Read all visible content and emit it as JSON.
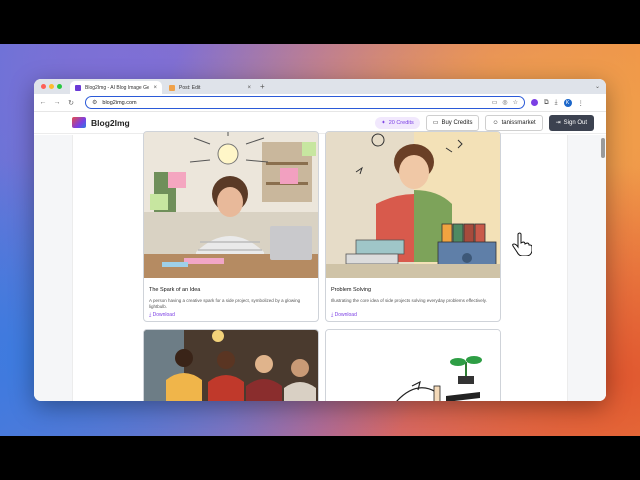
{
  "browser": {
    "tabs": [
      {
        "title": "Blog2Img - AI Blog Image Ge",
        "close": "×",
        "favicon_color": "#6b3ad6"
      },
      {
        "title": "Post: Edit",
        "close": "×",
        "favicon_color": "#f0a24a"
      }
    ],
    "new_tab": "+",
    "tab_menu": "⌄",
    "url": "blog2img.com",
    "profile_initial": "K"
  },
  "site": {
    "brand": "Blog2Img",
    "credits": "20 Credits",
    "buy_credits": "Buy Credits",
    "username": "tanissmarket",
    "sign_out": "Sign Out"
  },
  "cards": [
    {
      "title": "The Spark of an Idea",
      "description": "A person having a creative spark for a side project, symbolized by a glowing lightbulb.",
      "download": "Download"
    },
    {
      "title": "Problem Solving",
      "description": "Illustrating the core idea of side projects solving everyday problems effectively.",
      "download": "Download"
    },
    {
      "title": "",
      "description": "",
      "download": ""
    },
    {
      "title": "",
      "description": "",
      "download": ""
    }
  ],
  "colors": {
    "accent": "#7b3fe4",
    "dark_button": "#3c4250",
    "credits_bg": "#f1e8fd"
  }
}
